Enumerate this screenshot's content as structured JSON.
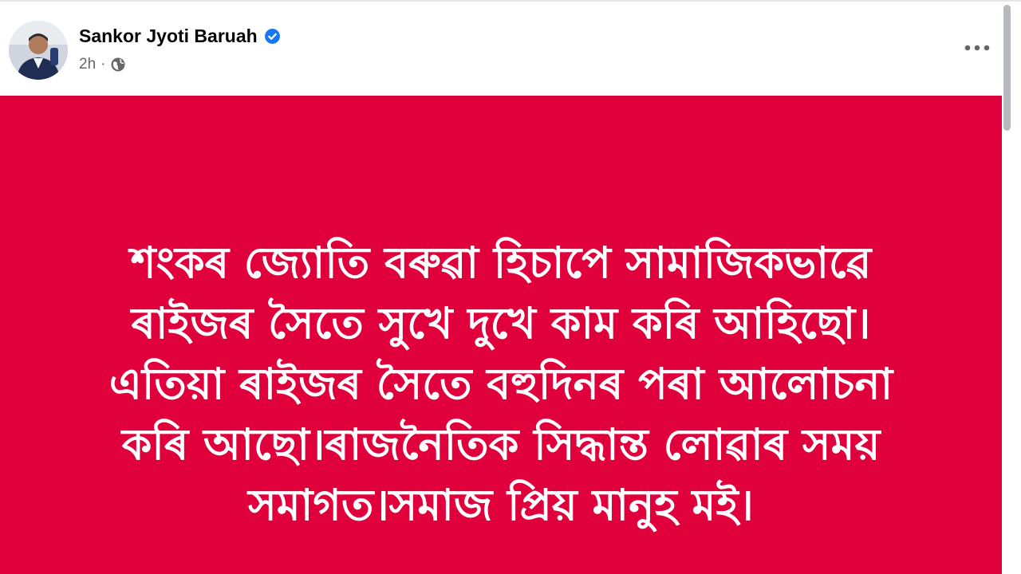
{
  "post": {
    "author": {
      "name": "Sankor Jyoti Baruah",
      "verified": true,
      "avatar_icon": "profile-photo-man-in-vest"
    },
    "meta": {
      "time": "2h",
      "separator": "·",
      "audience_icon": "globe-icon"
    },
    "menu_icon": "more-options-icon",
    "background_color": "#e0003b",
    "text_lines": [
      "শংকৰ জ্যোতি বৰুৱা হিচাপে সামাজিকভাৱে",
      "ৰাইজৰ সৈতে সুখে দুখে কাম কৰি আহিছো।",
      "এতিয়া ৰাইজৰ সৈতে বহুদিনৰ পৰা আলোচনা",
      "কৰি আছো।ৰাজনৈতিক সিদ্ধান্ত লোৱাৰ সময়",
      "সমাগত।সমাজ প্ৰিয় মানুহ মই।"
    ]
  }
}
